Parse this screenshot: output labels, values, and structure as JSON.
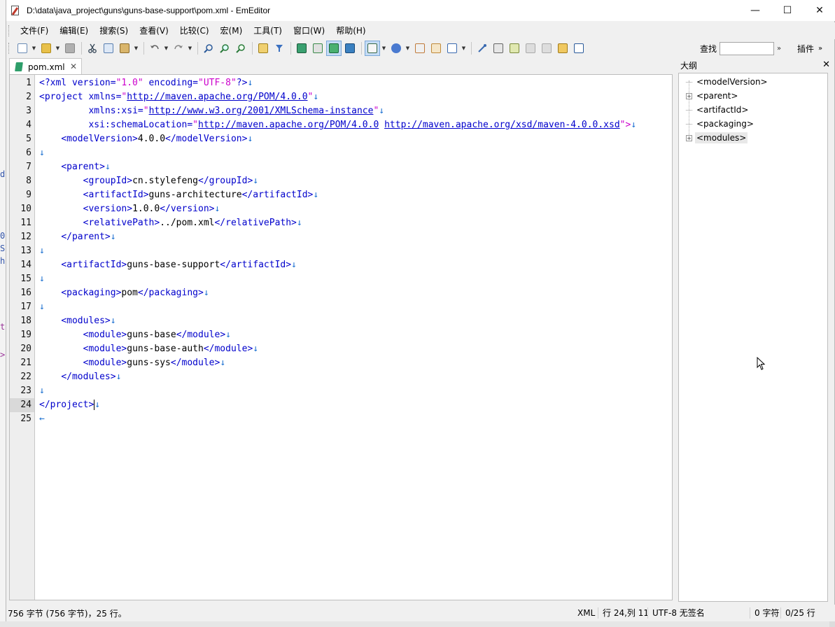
{
  "window": {
    "title": "D:\\data\\java_project\\guns\\guns-base-support\\pom.xml - EmEditor",
    "minimize": "—",
    "maximize": "☐",
    "close": "✕"
  },
  "menu": [
    "文件(F)",
    "编辑(E)",
    "搜索(S)",
    "查看(V)",
    "比较(C)",
    "宏(M)",
    "工具(T)",
    "窗口(W)",
    "帮助(H)"
  ],
  "search": {
    "label": "查找",
    "value": "",
    "more": "»"
  },
  "plugins": {
    "label": "插件",
    "more": "»"
  },
  "tab": {
    "label": "pom.xml",
    "close": "✕"
  },
  "outline": {
    "title": "大纲",
    "close": "✕",
    "items": [
      {
        "label": "<modelVersion>",
        "expandable": false
      },
      {
        "label": "<parent>",
        "expandable": true
      },
      {
        "label": "<artifactId>",
        "expandable": false
      },
      {
        "label": "<packaging>",
        "expandable": false
      },
      {
        "label": "<modules>",
        "expandable": true
      }
    ]
  },
  "editor": {
    "current_line": 24,
    "line_numbers": [
      "1",
      "2",
      "3",
      "4",
      "5",
      "6",
      "7",
      "8",
      "9",
      "10",
      "11",
      "12",
      "13",
      "14",
      "15",
      "16",
      "17",
      "18",
      "19",
      "20",
      "21",
      "22",
      "23",
      "24",
      "25"
    ]
  },
  "code": {
    "l1": {
      "t1": "<?xml version=",
      "s1": "\"1.0\"",
      "t2": " encoding=",
      "s2": "\"UTF-8\"",
      "t3": "?>",
      "m": "↓"
    },
    "l2": {
      "t1": "<project xmlns=",
      "q1": "\"",
      "u": "http://maven.apache.org/POM/4.0.0",
      "q2": "\"",
      "m": "↓"
    },
    "l3": {
      "pad": "         ",
      "t1": "xmlns:xsi=",
      "q1": "\"",
      "u": "http://www.w3.org/2001/XMLSchema-instance",
      "q2": "\"",
      "m": "↓"
    },
    "l4": {
      "pad": "         ",
      "t1": "xsi:schemaLocation=",
      "q1": "\"",
      "u1": "http://maven.apache.org/POM/4.0.0",
      "sp": " ",
      "u2": "http://maven.apache.org/xsd/maven-4.0.0.xsd",
      "q2": "\">",
      "m": "↓"
    },
    "l5": {
      "pad": "    ",
      "o": "<modelVersion>",
      "v": "4.0.0",
      "c": "</modelVersion>",
      "m": "↓"
    },
    "l6": {
      "m": "↓"
    },
    "l7": {
      "pad": "    ",
      "o": "<parent>",
      "m": "↓"
    },
    "l8": {
      "pad": "        ",
      "o": "<groupId>",
      "v": "cn.stylefeng",
      "c": "</groupId>",
      "m": "↓"
    },
    "l9": {
      "pad": "        ",
      "o": "<artifactId>",
      "v": "guns-architecture",
      "c": "</artifactId>",
      "m": "↓"
    },
    "l10": {
      "pad": "        ",
      "o": "<version>",
      "v": "1.0.0",
      "c": "</version>",
      "m": "↓"
    },
    "l11": {
      "pad": "        ",
      "o": "<relativePath>",
      "v": "../pom.xml",
      "c": "</relativePath>",
      "m": "↓"
    },
    "l12": {
      "pad": "    ",
      "o": "</parent>",
      "m": "↓"
    },
    "l13": {
      "m": "↓"
    },
    "l14": {
      "pad": "    ",
      "o": "<artifactId>",
      "v": "guns-base-support",
      "c": "</artifactId>",
      "m": "↓"
    },
    "l15": {
      "m": "↓"
    },
    "l16": {
      "pad": "    ",
      "o": "<packaging>",
      "v": "pom",
      "c": "</packaging>",
      "m": "↓"
    },
    "l17": {
      "m": "↓"
    },
    "l18": {
      "pad": "    ",
      "o": "<modules>",
      "m": "↓"
    },
    "l19": {
      "pad": "        ",
      "o": "<module>",
      "v": "guns-base",
      "c": "</module>",
      "m": "↓"
    },
    "l20": {
      "pad": "        ",
      "o": "<module>",
      "v": "guns-base-auth",
      "c": "</module>",
      "m": "↓"
    },
    "l21": {
      "pad": "        ",
      "o": "<module>",
      "v": "guns-sys",
      "c": "</module>",
      "m": "↓"
    },
    "l22": {
      "pad": "    ",
      "o": "</modules>",
      "m": "↓"
    },
    "l23": {
      "m": "↓"
    },
    "l24": {
      "o": "</project>",
      "m": "↓"
    },
    "l25": {
      "m": "←"
    }
  },
  "status": {
    "size": "756 字节 (756 字节)，25 行。",
    "type": "XML",
    "position": "行 24,列 11",
    "encoding": "UTF-8 无签名",
    "selection": "0 字符",
    "lines": "0/25 行"
  },
  "background_fragments": [
    "d",
    "0",
    "S",
    "h",
    "t",
    ">"
  ],
  "colors": {
    "tag": "#0000cc",
    "string": "#cc00cc",
    "marker": "#1a6fd0"
  }
}
